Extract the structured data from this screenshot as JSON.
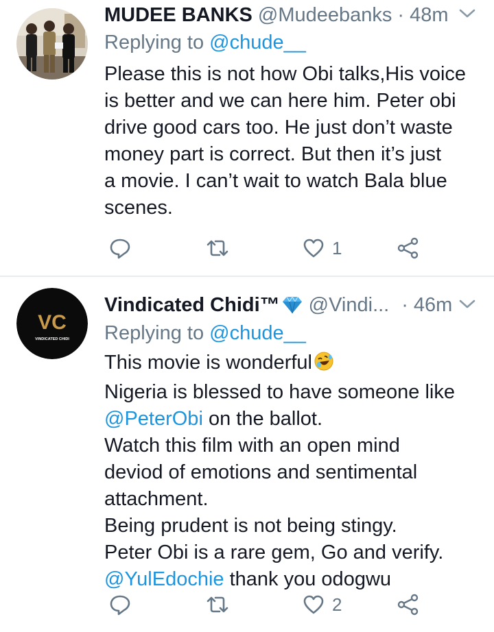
{
  "tweets": [
    {
      "name": "MUDEE BANKS",
      "handle": "@Mudeebanks",
      "separator": "·",
      "time": "48m",
      "replying_prefix": "Replying to",
      "replying_to": "@chude__",
      "lines": [
        "Please this is not how Obi talks,His voice",
        "is better and we can here him. Peter obi",
        "drive good cars too. He just don’t waste",
        "money part  is correct.  But then it’s just",
        "a movie. I can’t wait to watch Bala blue",
        "scenes."
      ],
      "like_count": "1"
    },
    {
      "name": "Vindicated Chidi™",
      "handle": "@Vindi...",
      "separator": "·",
      "time": "46m",
      "replying_prefix": "Replying to",
      "replying_to": "@chude__",
      "lines": [
        {
          "text": "This movie is wonderful"
        },
        {
          "text": "Nigeria is blessed to have someone like"
        },
        {
          "mention": "@PeterObi",
          "text": " on the ballot."
        },
        {
          "text": "Watch this film with an open mind"
        },
        {
          "text": "deviod of emotions and sentimental"
        },
        {
          "text": "attachment."
        },
        {
          "text": "Being prudent is not being stingy."
        },
        {
          "text": "Peter Obi is a rare gem, Go and verify."
        },
        {
          "mention": "@YulEdochie",
          "text": " thank you odogwu"
        }
      ],
      "avatar_logo_text": "VC",
      "avatar_caption": "VINDICATED CHIDI",
      "like_count": "2"
    }
  ],
  "icons": {
    "chevron": "chevron-down-icon",
    "reply": "reply-icon",
    "retweet": "retweet-icon",
    "like": "heart-icon",
    "share": "share-icon",
    "verified_gem": "gem-emoji",
    "laugh": "rolling-laugh-emoji"
  },
  "colors": {
    "link": "#1b95e0",
    "muted": "#657786",
    "text": "#141823",
    "divider": "#e6ecf0",
    "gem": "#4fb4f0",
    "avatar2_bg": "#0b0b0b",
    "avatar2_gold": "#c89a4a"
  }
}
